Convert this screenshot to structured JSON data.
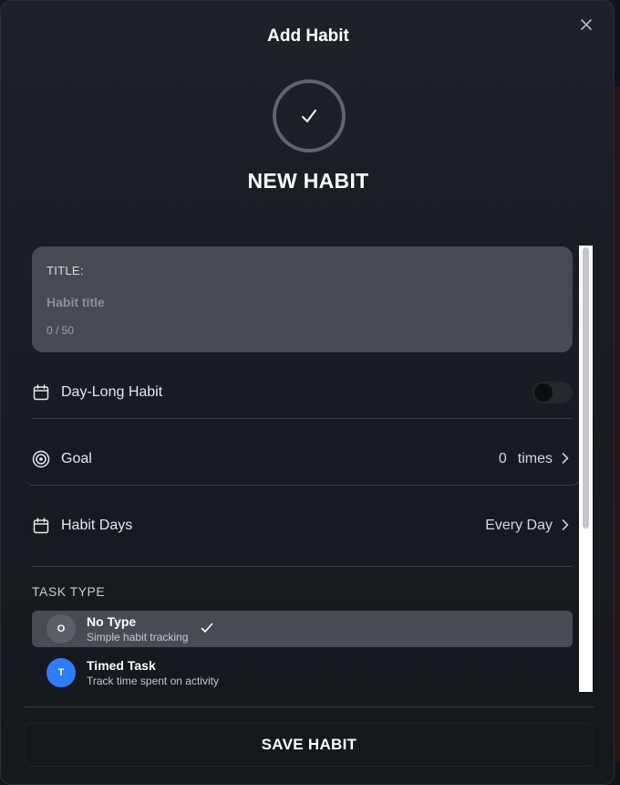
{
  "modal": {
    "title": "Add Habit",
    "close_symbol": "✕",
    "hero_icon": "checkmark-icon",
    "hero_title": "NEW HABIT"
  },
  "title_field": {
    "label": "TITLE:",
    "placeholder": "Habit title",
    "value": "",
    "counter": "0 / 50"
  },
  "day_long": {
    "label": "Day-Long Habit",
    "icon": "calendar-icon",
    "enabled": false
  },
  "goal": {
    "label": "Goal",
    "icon": "target-icon",
    "value": "0",
    "unit": "times"
  },
  "habit_days": {
    "label": "Habit Days",
    "icon": "calendar-icon",
    "value": "Every Day"
  },
  "task_type": {
    "section_label": "TASK TYPE",
    "options": [
      {
        "badge": "O",
        "name": "No Type",
        "description": "Simple habit tracking",
        "selected": true,
        "color": "#5b6068"
      },
      {
        "badge": "T",
        "name": "Timed Task",
        "description": "Track time spent on activity",
        "selected": false,
        "color": "#2f7df6"
      }
    ]
  },
  "footer": {
    "save_label": "SAVE HABIT"
  },
  "colors": {
    "modal_bg": "#1d2128",
    "card_bg": "#464a52",
    "selected_bg": "#474b53",
    "accent_blue": "#2f7df6"
  }
}
